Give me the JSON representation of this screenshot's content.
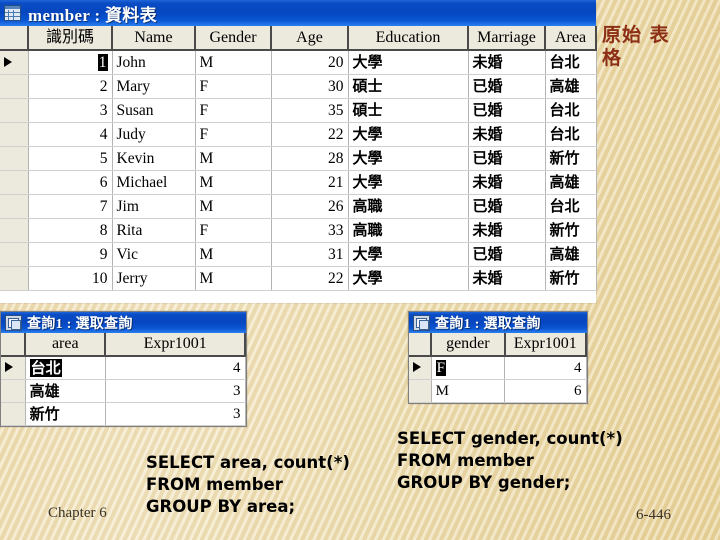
{
  "member_window": {
    "icon": "datasheet-icon",
    "title": "member : 資料表",
    "columns": [
      "識別碼",
      "Name",
      "Gender",
      "Age",
      "Education",
      "Marriage",
      "Area"
    ],
    "rows": [
      {
        "id": "1",
        "name": "John",
        "gender": "M",
        "age": "20",
        "education": "大學",
        "marriage": "未婚",
        "area": "台北"
      },
      {
        "id": "2",
        "name": "Mary",
        "gender": "F",
        "age": "30",
        "education": "碩士",
        "marriage": "已婚",
        "area": "高雄"
      },
      {
        "id": "3",
        "name": "Susan",
        "gender": "F",
        "age": "35",
        "education": "碩士",
        "marriage": "已婚",
        "area": "台北"
      },
      {
        "id": "4",
        "name": "Judy",
        "gender": "F",
        "age": "22",
        "education": "大學",
        "marriage": "未婚",
        "area": "台北"
      },
      {
        "id": "5",
        "name": "Kevin",
        "gender": "M",
        "age": "28",
        "education": "大學",
        "marriage": "已婚",
        "area": "新竹"
      },
      {
        "id": "6",
        "name": "Michael",
        "gender": "M",
        "age": "21",
        "education": "大學",
        "marriage": "未婚",
        "area": "高雄"
      },
      {
        "id": "7",
        "name": "Jim",
        "gender": "M",
        "age": "26",
        "education": "高職",
        "marriage": "已婚",
        "area": "台北"
      },
      {
        "id": "8",
        "name": "Rita",
        "gender": "F",
        "age": "33",
        "education": "高職",
        "marriage": "未婚",
        "area": "新竹"
      },
      {
        "id": "9",
        "name": "Vic",
        "gender": "M",
        "age": "31",
        "education": "大學",
        "marriage": "已婚",
        "area": "高雄"
      },
      {
        "id": "10",
        "name": "Jerry",
        "gender": "M",
        "age": "22",
        "education": "大學",
        "marriage": "未婚",
        "area": "新竹"
      }
    ]
  },
  "query_area_window": {
    "icon": "query-icon",
    "title": "查詢1 : 選取查詢",
    "columns": [
      "area",
      "Expr1001"
    ],
    "rows": [
      {
        "area": "台北",
        "count": "4"
      },
      {
        "area": "高雄",
        "count": "3"
      },
      {
        "area": "新竹",
        "count": "3"
      }
    ]
  },
  "query_gender_window": {
    "icon": "query-icon",
    "title": "查詢1 : 選取查詢",
    "columns": [
      "gender",
      "Expr1001"
    ],
    "rows": [
      {
        "gender": "F",
        "count": "4"
      },
      {
        "gender": "M",
        "count": "6"
      }
    ]
  },
  "annotations": {
    "original_table_label": "原始\n表格",
    "original_table_color": "#8c2f16",
    "sql_area": "SELECT area, count(*)\nFROM member\nGROUP BY area;",
    "sql_gender": "SELECT gender, count(*)\nFROM member\nGROUP BY gender;"
  },
  "footer": {
    "chapter": "Chapter 6",
    "page": "6-446"
  }
}
